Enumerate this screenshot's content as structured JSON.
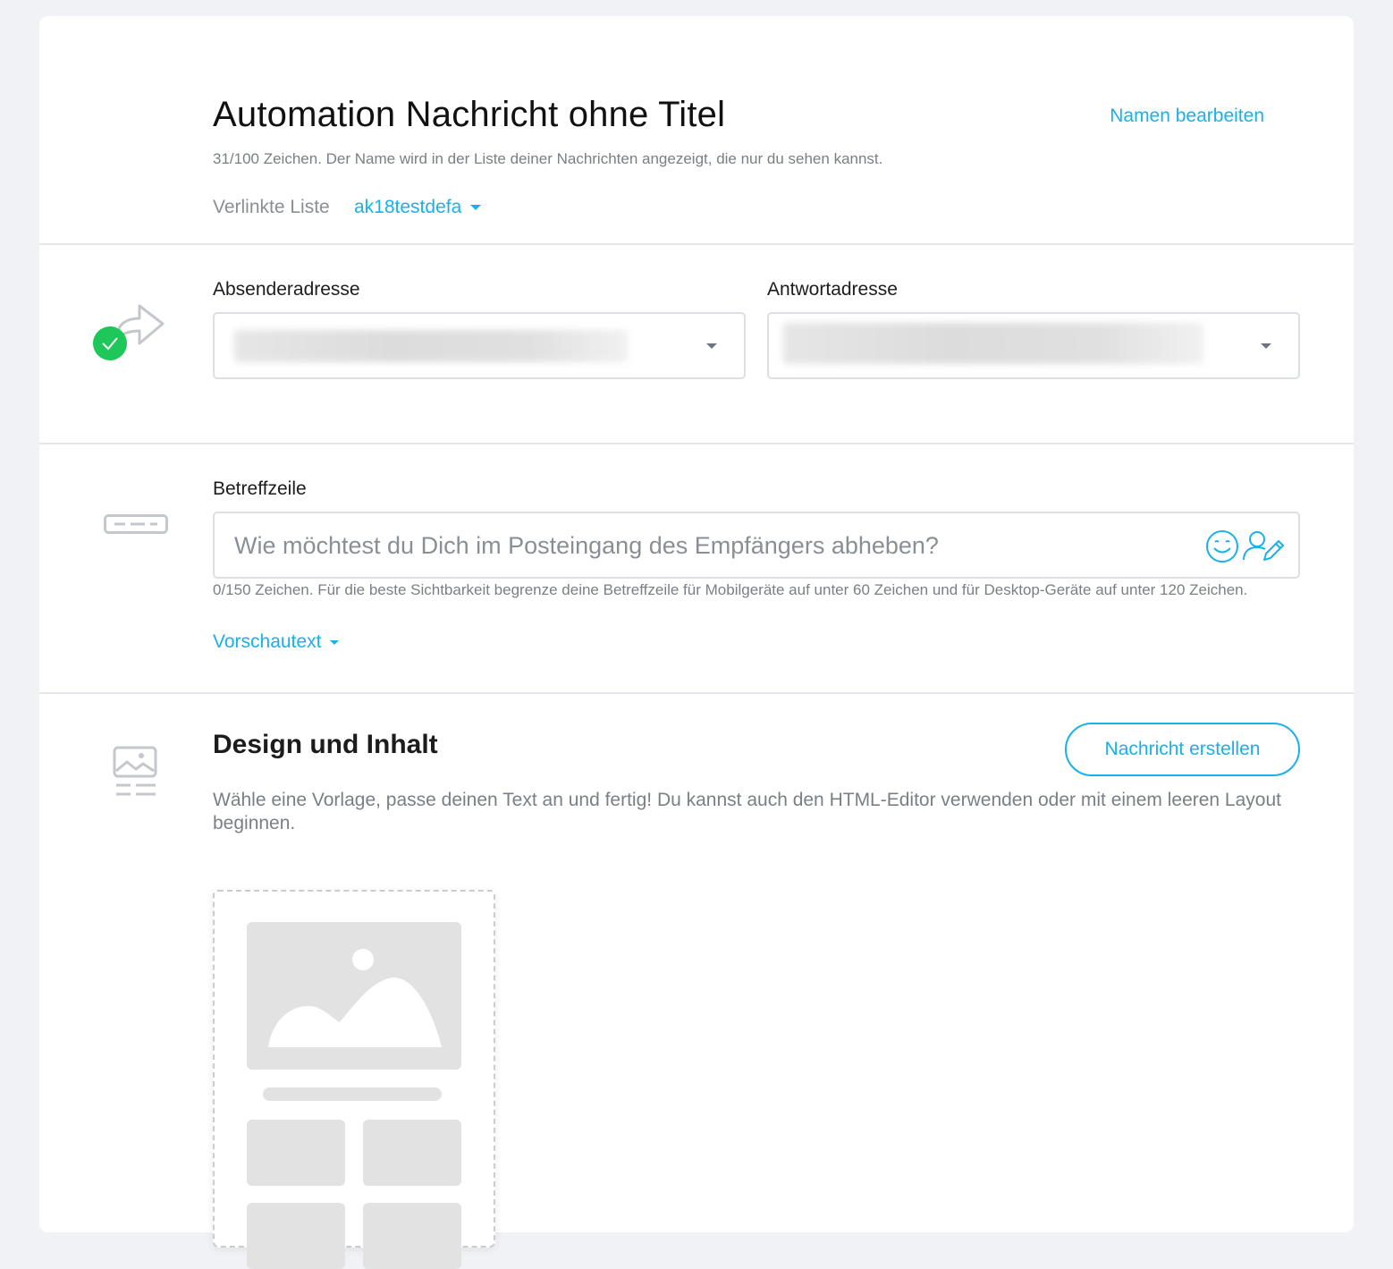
{
  "header": {
    "title": "Automation Nachricht ohne Titel",
    "edit_name_label": "Namen bearbeiten",
    "title_hint": "31/100 Zeichen. Der Name wird in der Liste deiner Nachrichten angezeigt, die nur du sehen kannst.",
    "linked_list_label": "Verlinkte Liste",
    "linked_list_value": "ak18testdefa"
  },
  "sender": {
    "from_label": "Absenderadresse",
    "reply_label": "Antwortadresse",
    "status_icon": "check-circle-icon",
    "status_color": "#1ec75a"
  },
  "subject": {
    "label": "Betreffzeile",
    "placeholder": "Wie möchtest du Dich im Posteingang des Empfängers abheben?",
    "value": "",
    "hint": "0/150 Zeichen. Für die beste Sichtbarkeit begrenze deine Betreffzeile für Mobilgeräte auf unter 60 Zeichen und für Desktop-Geräte auf unter 120 Zeichen.",
    "preview_text_label": "Vorschautext"
  },
  "design": {
    "title": "Design und Inhalt",
    "create_button_label": "Nachricht erstellen",
    "description": "Wähle eine Vorlage, passe deinen Text an und fertig! Du kannst auch den HTML-Editor verwenden oder mit einem leeren Layout beginnen."
  },
  "colors": {
    "accent": "#1ab0e8",
    "success": "#1ec75a",
    "background": "#f1f2f5"
  }
}
